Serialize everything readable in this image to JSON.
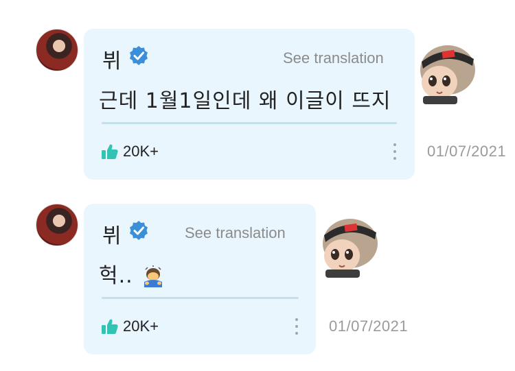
{
  "posts": [
    {
      "author": "뷔",
      "see_translation": "See translation",
      "text": "근데 1월1일인데 왜 이글이 뜨지",
      "likes": "20K+",
      "date": "01/07/2021",
      "verified_icon": "verified-badge-icon",
      "like_icon": "thumbs-up-icon"
    },
    {
      "author": "뷔",
      "see_translation": "See translation",
      "text": "헉..",
      "emoji": "person-bowing-emoji",
      "likes": "20K+",
      "date": "01/07/2021",
      "verified_icon": "verified-badge-icon",
      "like_icon": "thumbs-up-icon"
    }
  ],
  "colors": {
    "bubble": "#e9f6fd",
    "verified": "#3b8fd9",
    "like": "#33c3b5",
    "muted": "#8b8b8b"
  }
}
